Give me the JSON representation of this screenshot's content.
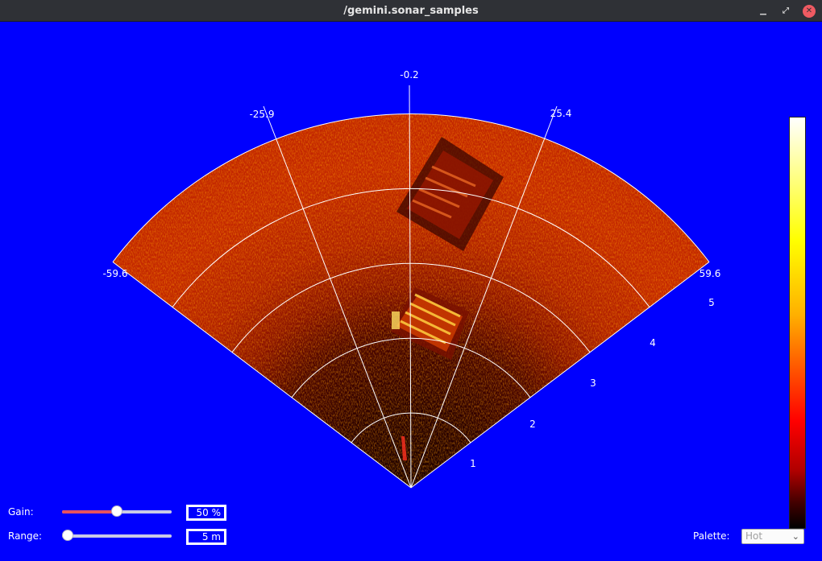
{
  "window": {
    "title": "/gemini.sonar_samples",
    "controls": {
      "minimize_icon": "minimize-icon",
      "restore_icon": "restore-icon",
      "close_icon": "close-icon"
    }
  },
  "sonar": {
    "bearing_labels": [
      "-59.6",
      "-25.9",
      "-0.2",
      "25.4",
      "59.6"
    ],
    "range_labels": [
      "1",
      "2",
      "3",
      "4",
      "5"
    ]
  },
  "colorbar": {
    "palette": "Hot"
  },
  "controls": {
    "gain": {
      "label": "Gain:",
      "value": "50 %",
      "level_fraction": 0.5
    },
    "range": {
      "label": "Range:",
      "value": "5 m",
      "level_fraction": 0.0
    },
    "palette": {
      "label": "Palette:",
      "selected": "Hot"
    }
  },
  "colors": {
    "background": "#0000fe",
    "titlebar": "#2f3136",
    "slider_fill": "#e5525e",
    "close_button": "#ef5a62"
  }
}
